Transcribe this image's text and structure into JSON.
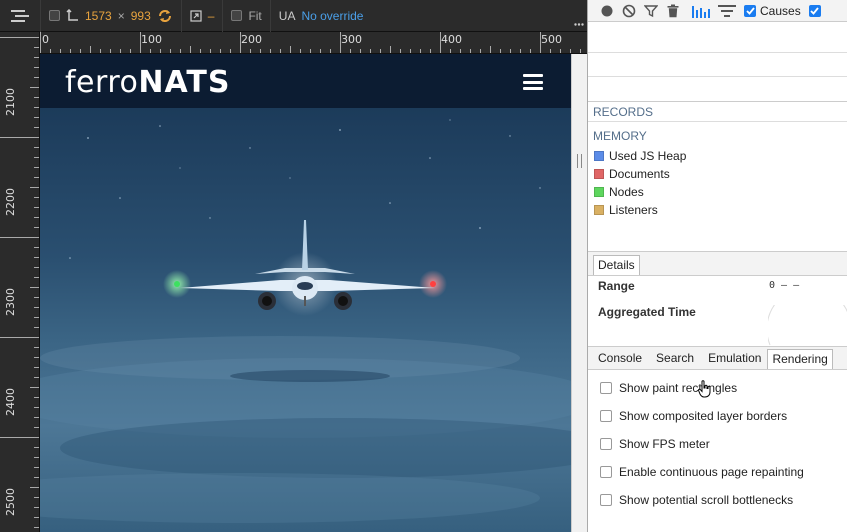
{
  "emulation_toolbar": {
    "width_value": "1573",
    "times_sign": "×",
    "height_value": "993",
    "scale_dash": "–",
    "fit_label": "Fit",
    "ua_label": "UA",
    "ua_value": "No override"
  },
  "ruler_top": {
    "labels": [
      "0",
      "100",
      "200",
      "300",
      "400",
      "500"
    ]
  },
  "ruler_left": {
    "labels": [
      "2100",
      "2200",
      "2300",
      "2400",
      "2500"
    ]
  },
  "page": {
    "logo_part1": "ferro",
    "logo_part2": "NATS"
  },
  "devtools": {
    "toolbar": {
      "causes_label": "Causes"
    },
    "records_label": "RECORDS",
    "memory_label": "MEMORY",
    "legend": [
      {
        "label": "Used JS Heap",
        "color": "#5b8ce8"
      },
      {
        "label": "Documents",
        "color": "#e06666"
      },
      {
        "label": "Nodes",
        "color": "#5ed65e"
      },
      {
        "label": "Listeners",
        "color": "#d9b063"
      }
    ],
    "details_tab": "Details",
    "range_label": "Range",
    "range_value": "0 – –",
    "aggregated_time_label": "Aggregated Time",
    "bottom_tabs": [
      "Console",
      "Search",
      "Emulation",
      "Rendering"
    ],
    "active_tab": "Rendering",
    "rendering_options": [
      "Show paint rectangles",
      "Show composited layer borders",
      "Show FPS meter",
      "Enable continuous page repainting",
      "Show potential scroll bottlenecks"
    ]
  },
  "colors": {
    "toolbar_bg": "#2b2b2b",
    "orange_value": "#e8a33e",
    "link_blue": "#4a9fe8",
    "section_label": "#546e8a",
    "checkbox_blue": "#1a7cf0"
  }
}
